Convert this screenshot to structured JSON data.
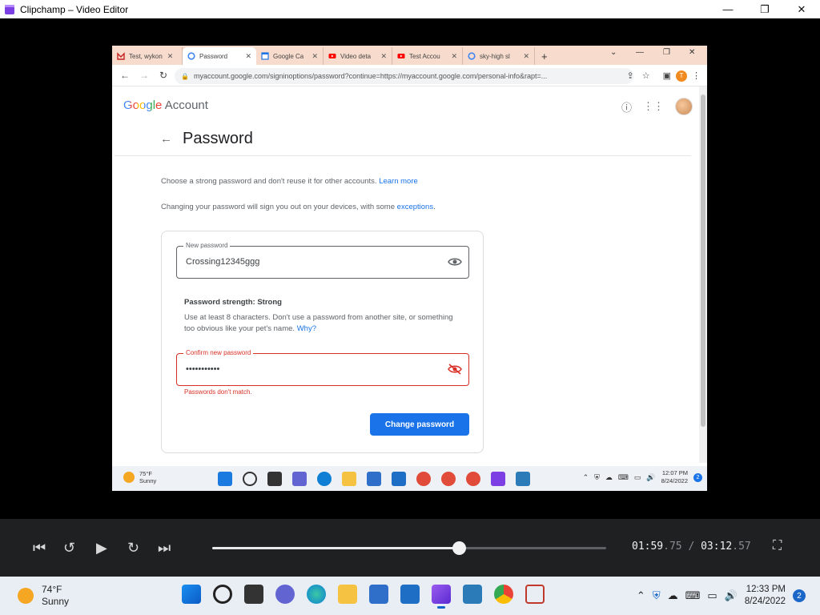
{
  "window": {
    "title": "Clipchamp – Video Editor",
    "minimize": "—",
    "maximize": "❐",
    "close": "✕"
  },
  "browser": {
    "tabs": [
      {
        "label": "Test, wykon",
        "icon": "gmail-icon",
        "color": "#c5221f",
        "active": false
      },
      {
        "label": "Password",
        "icon": "google-icon",
        "color": "#4285f4",
        "active": true
      },
      {
        "label": "Google Ca",
        "icon": "google-calendar-icon",
        "color": "#1a73e8",
        "active": false
      },
      {
        "label": "Video deta",
        "icon": "youtube-icon",
        "color": "#ff0000",
        "active": false
      },
      {
        "label": "Test Accou",
        "icon": "youtube-icon",
        "color": "#ff0000",
        "active": false
      },
      {
        "label": "sky-high sl",
        "icon": "google-icon",
        "color": "#4285f4",
        "active": false
      }
    ],
    "new_tab": "+",
    "url": "myaccount.google.com/signinoptions/password?continue=https://myaccount.google.com/personal-info&rapt=...",
    "profile_initial": "T"
  },
  "page": {
    "logo_google": "Google",
    "logo_account": "Account",
    "title": "Password",
    "back": "←",
    "desc1": "Choose a strong password and don't reuse it for other accounts.",
    "desc1_link": "Learn more",
    "desc2": "Changing your password will sign you out on your devices, with some",
    "desc2_link": "exceptions",
    "new_password_label": "New password",
    "new_password_value": "Crossing12345ggg",
    "strength_title": "Password strength: Strong",
    "strength_desc": "Use at least 8 characters. Don't use a password from another site, or something too obvious like your pet's name.",
    "strength_link": "Why?",
    "confirm_label": "Confirm new password",
    "confirm_value": "•••••••••••",
    "error": "Passwords don't match.",
    "button": "Change password"
  },
  "video_taskbar": {
    "temp": "75°F",
    "weather": "Sunny",
    "time": "12:07 PM",
    "date": "8/24/2022",
    "badge": "2"
  },
  "player": {
    "current_time": "01:59",
    "current_frac": ".75",
    "total_time": "03:12",
    "total_frac": ".57",
    "separator": "/",
    "progress": 0.625
  },
  "taskbar": {
    "temp": "74°F",
    "weather": "Sunny",
    "time": "12:33 PM",
    "date": "8/24/2022",
    "badge": "2"
  },
  "colors": {
    "accent": "#1a73e8",
    "error": "#d93025",
    "tab_strip": "#f7dccd"
  }
}
